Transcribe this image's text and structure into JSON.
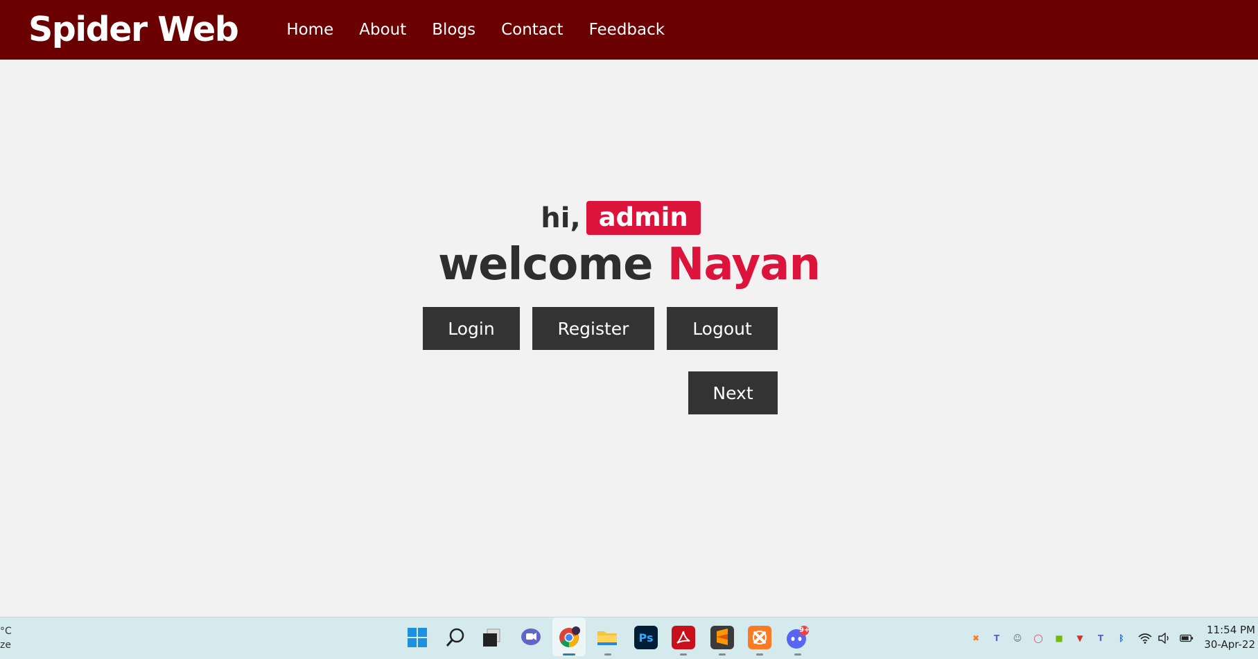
{
  "header": {
    "brand": "Spider Web",
    "nav": [
      "Home",
      "About",
      "Blogs",
      "Contact",
      "Feedback"
    ]
  },
  "hero": {
    "greeting": "hi,",
    "role": "admin",
    "welcome": "welcome",
    "name": "Nayan"
  },
  "buttons": {
    "login": "Login",
    "register": "Register",
    "logout": "Logout",
    "next": "Next"
  },
  "taskbar": {
    "weather_line1": "°C",
    "weather_line2": "ze",
    "time": "11:54 PM",
    "date": "30-Apr-22",
    "notification_badge": "9+"
  },
  "colors": {
    "header_bg": "#6a0000",
    "accent": "#dc143c",
    "button_bg": "#333333"
  }
}
